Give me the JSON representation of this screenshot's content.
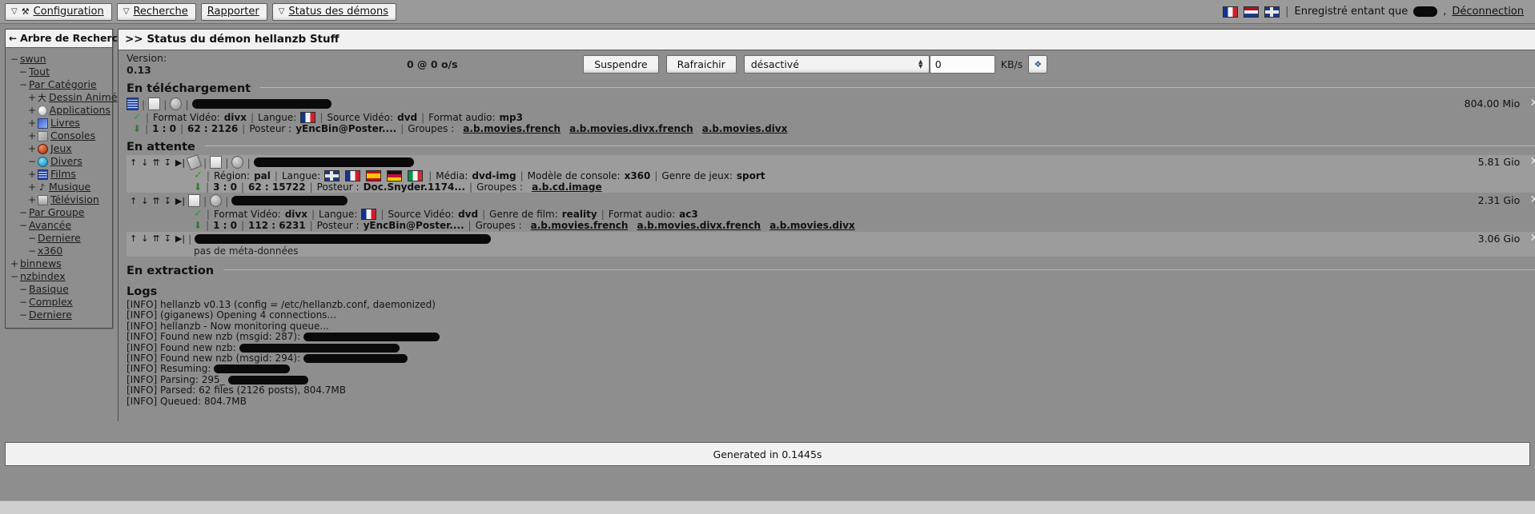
{
  "menubar": {
    "tabs": [
      {
        "label": "Configuration",
        "caret": true,
        "icon": "wrench-icon"
      },
      {
        "label": "Recherche",
        "caret": true,
        "icon": null
      },
      {
        "label": "Rapporter",
        "caret": false,
        "icon": null
      },
      {
        "label": "Status des démons",
        "caret": true,
        "icon": null
      }
    ],
    "flags": [
      "flag-fr",
      "flag-nl",
      "flag-uk"
    ],
    "session_text": "Enregistré entant que",
    "username_redacted": "",
    "comma": ",",
    "logout_label": "Déconnection"
  },
  "sidebar": {
    "title": "Arbre de Recherche",
    "back_icon": "back-arrow-icon",
    "items": [
      {
        "label": "swun",
        "toggle": "−",
        "depth": 0,
        "icon": null
      },
      {
        "label": "Tout",
        "toggle": "−",
        "depth": 1,
        "icon": null
      },
      {
        "label": "Par Catégorie",
        "toggle": "−",
        "depth": 1,
        "icon": null
      },
      {
        "label": "Dessin Animé",
        "toggle": "+",
        "depth": 2,
        "icon": "ico-anime",
        "glyph": "大"
      },
      {
        "label": "Applications",
        "toggle": "+",
        "depth": 2,
        "icon": "ico-apps",
        "glyph": ""
      },
      {
        "label": "Livres",
        "toggle": "+",
        "depth": 2,
        "icon": "ico-livres",
        "glyph": ""
      },
      {
        "label": "Consoles",
        "toggle": "+",
        "depth": 2,
        "icon": "ico-consoles",
        "glyph": ""
      },
      {
        "label": "Jeux",
        "toggle": "+",
        "depth": 2,
        "icon": "ico-jeux",
        "glyph": ""
      },
      {
        "label": "Divers",
        "toggle": "−",
        "depth": 2,
        "icon": "ico-divers",
        "glyph": ""
      },
      {
        "label": "Films",
        "toggle": "+",
        "depth": 2,
        "icon": "ico-films",
        "glyph": ""
      },
      {
        "label": "Musique",
        "toggle": "+",
        "depth": 2,
        "icon": "ico-musique",
        "glyph": "♪"
      },
      {
        "label": "Télévision",
        "toggle": "+",
        "depth": 2,
        "icon": "ico-tv",
        "glyph": ""
      },
      {
        "label": "Par Groupe",
        "toggle": "−",
        "depth": 1,
        "icon": null
      },
      {
        "label": "Avancée",
        "toggle": "−",
        "depth": 1,
        "icon": null
      },
      {
        "label": "Derniere",
        "toggle": "−",
        "depth": 2,
        "icon": null
      },
      {
        "label": "x360",
        "toggle": "−",
        "depth": 2,
        "icon": null
      },
      {
        "label": "binnews",
        "toggle": "+",
        "depth": 0,
        "icon": null
      },
      {
        "label": "nzbindex",
        "toggle": "−",
        "depth": 0,
        "icon": null
      },
      {
        "label": "Basique",
        "toggle": "−",
        "depth": 1,
        "icon": null
      },
      {
        "label": "Complex",
        "toggle": "−",
        "depth": 1,
        "icon": null
      },
      {
        "label": "Derniere",
        "toggle": "−",
        "depth": 1,
        "icon": null
      }
    ]
  },
  "main": {
    "header": ">> Status du démon hellanzb Stuff",
    "toolbar": {
      "version_label": "Version:",
      "version_value": "0.13",
      "rate": "0 @ 0 o/s",
      "suspend_label": "Suspendre",
      "refresh_label": "Rafraichir",
      "select_value": "désactivé",
      "speed_value": "0",
      "speed_unit": "KB/s",
      "apply_icon": "apply-icon"
    },
    "sections": {
      "downloading": "En téléchargement",
      "waiting": "En attente",
      "extracting": "En extraction",
      "logs": "Logs"
    },
    "downloading_items": [
      {
        "size": "804.00 Mio",
        "icons": [
          "mini-film",
          "mini-doc",
          "mini-globe"
        ],
        "meta": [
          {
            "key": "Format Vidéo:",
            "value": "divx"
          },
          {
            "key": "Langue:",
            "value": "",
            "flag": "flag-fr"
          },
          {
            "key": "Source Vidéo:",
            "value": "dvd"
          },
          {
            "key": "Format audio:",
            "value": "mp3"
          }
        ],
        "stats": [
          "1 : 0",
          "62 : 2126"
        ],
        "poster_key": "Posteur :",
        "poster_value": "yEncBin@Poster....",
        "groups_key": "Groupes :",
        "groups": [
          "a.b.movies.french",
          "a.b.movies.divx.french",
          "a.b.movies.divx"
        ]
      }
    ],
    "waiting_items": [
      {
        "size": "5.81 Gio",
        "icons": [
          "mini-tag",
          "mini-doc",
          "mini-globe"
        ],
        "meta": [
          {
            "key": "Région:",
            "value": "pal"
          },
          {
            "key": "Langue:",
            "value": "",
            "flags": [
              "flag-uk",
              "flag-fr",
              "flag-es",
              "flag-de",
              "flag-it"
            ]
          },
          {
            "key": "Média:",
            "value": "dvd-img"
          },
          {
            "key": "Modèle de console:",
            "value": "x360"
          },
          {
            "key": "Genre de jeux:",
            "value": "sport"
          }
        ],
        "stats": [
          "3 : 0",
          "62 : 15722"
        ],
        "poster_key": "Posteur :",
        "poster_value": "Doc.Snyder.1174...",
        "groups_key": "Groupes :",
        "groups": [
          "a.b.cd.image"
        ],
        "has_meta": true
      },
      {
        "size": "2.31 Gio",
        "icons": [
          "mini-doc",
          "mini-globe"
        ],
        "meta": [
          {
            "key": "Format Vidéo:",
            "value": "divx"
          },
          {
            "key": "Langue:",
            "value": "",
            "flag": "flag-fr"
          },
          {
            "key": "Source Vidéo:",
            "value": "dvd"
          },
          {
            "key": "Genre de film:",
            "value": "reality"
          },
          {
            "key": "Format audio:",
            "value": "ac3"
          }
        ],
        "stats": [
          "1 : 0",
          "112 : 6231"
        ],
        "poster_key": "Posteur :",
        "poster_value": "yEncBin@Poster....",
        "groups_key": "Groupes :",
        "groups": [
          "a.b.movies.french",
          "a.b.movies.divx.french",
          "a.b.movies.divx"
        ],
        "has_meta": true
      },
      {
        "size": "3.06 Gio",
        "icons": [],
        "meta": [],
        "no_meta_text": "pas de méta-données",
        "has_meta": false
      }
    ],
    "logs": [
      "[INFO] hellanzb v0.13 (config = /etc/hellanzb.conf, daemonized)",
      "[INFO] (giganews) Opening 4 connections...",
      "[INFO] hellanzb - Now monitoring queue...",
      "[INFO] Found new nzb (msgid: 287):",
      "[INFO] Found new nzb:",
      "[INFO] Found new nzb (msgid: 294):",
      "[INFO] Resuming:",
      "[INFO] Parsing: 295_",
      "[INFO] Parsed: 62 files (2126 posts), 804.7MB",
      "[INFO] Queued: 804.7MB"
    ]
  },
  "footer": {
    "generated": "Generated in 0.1445s"
  },
  "colors": {
    "accent": "#2aa22a",
    "chrome": "#8e8e8e",
    "panel": "#f1f1f1"
  }
}
